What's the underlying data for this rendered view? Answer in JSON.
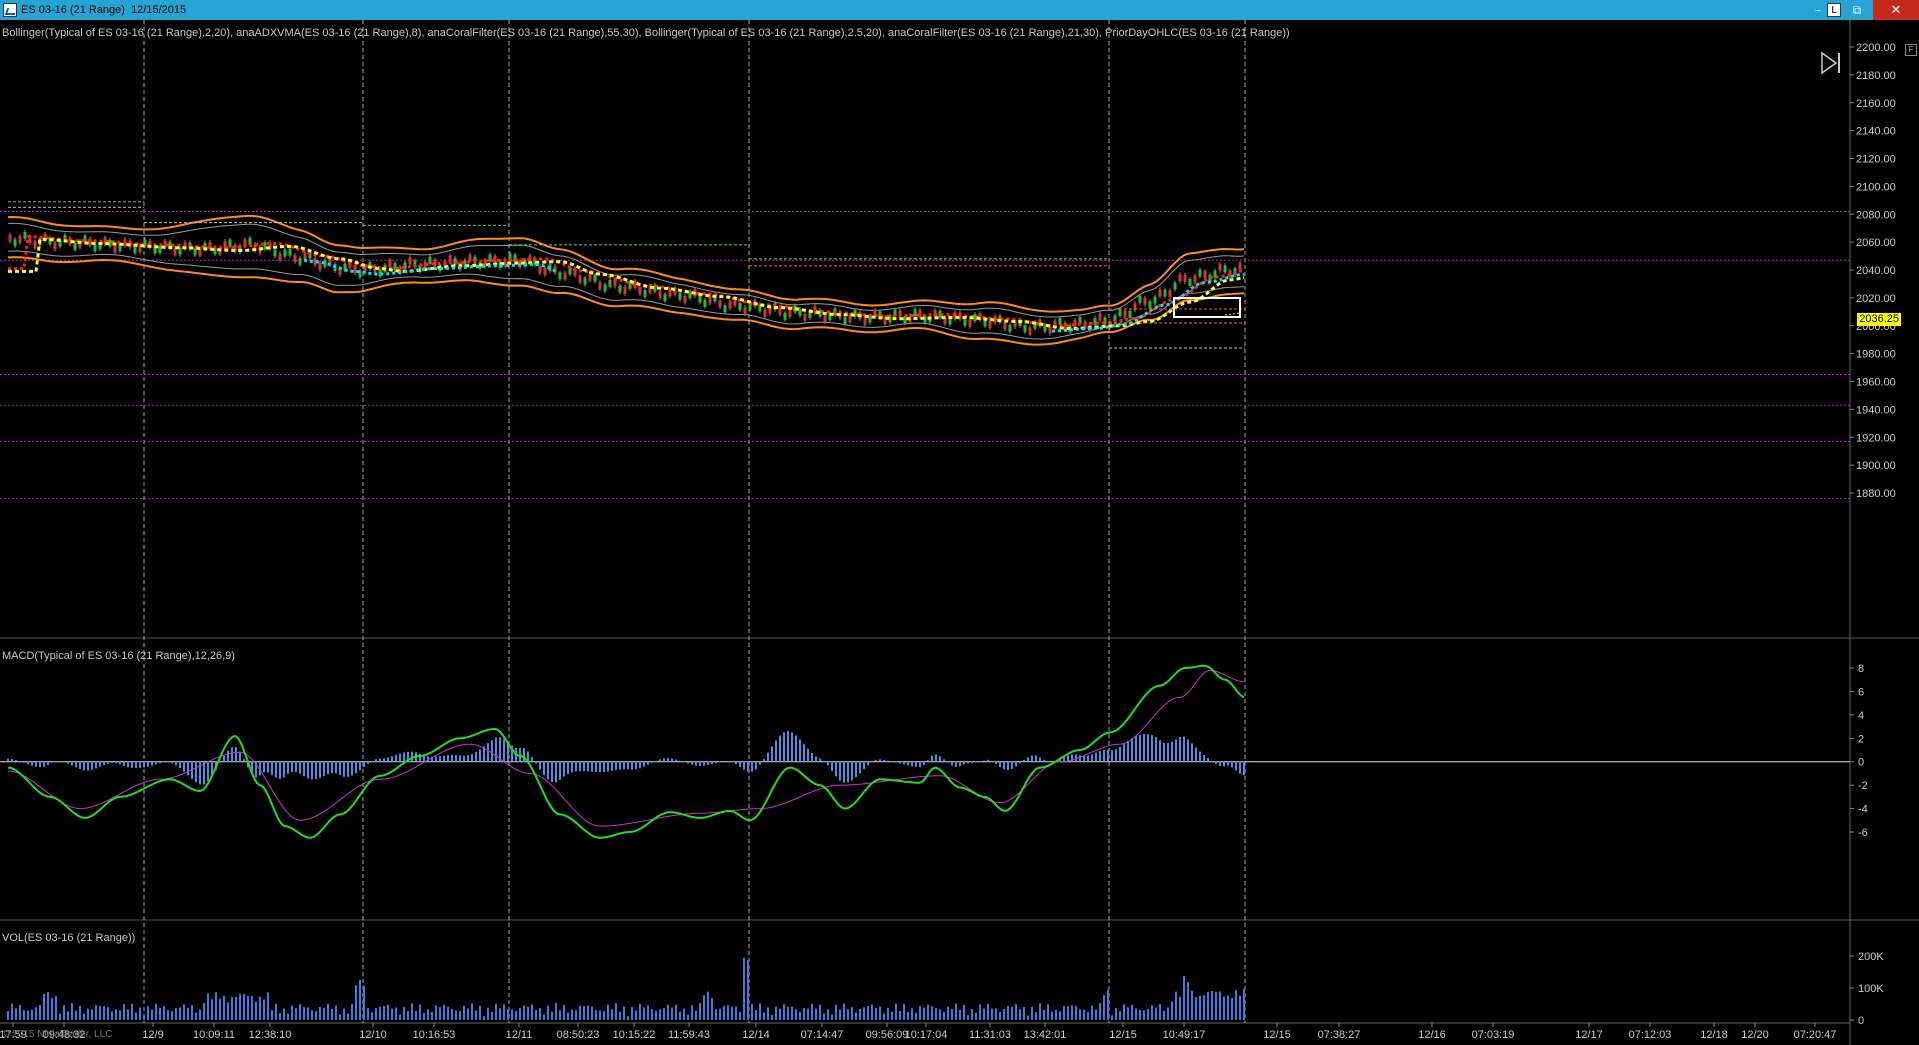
{
  "window": {
    "title": "ES 03-16 (21 Range)  12/15/2015",
    "buttons": {
      "minimize": "–",
      "link": "L",
      "restore": "⧉",
      "close": "✕"
    }
  },
  "panels": {
    "price": {
      "label": "Bollinger(Typical of ES 03-16 (21 Range),2,20), anaADXVMA(ES 03-16 (21 Range),8), anaCoralFilter(ES 03-16 (21 Range),55,30), Bollinger(Typical of ES 03-16 (21 Range),2.5,20), anaCoralFilter(ES 03-16 (21 Range),21,30), PriorDayOHLC(ES 03-16 (21 Range))",
      "y_ticks": [
        "2200.00",
        "2180.00",
        "2160.00",
        "2140.00",
        "2120.00",
        "2100.00",
        "2080.00",
        "2060.00",
        "2040.00",
        "2020.00",
        "2000.00",
        "1980.00",
        "1960.00",
        "1940.00",
        "1920.00",
        "1900.00",
        "1880.00"
      ],
      "last_price": "2036.25"
    },
    "macd": {
      "label": "MACD(Typical of ES 03-16 (21 Range),12,26,9)",
      "y_ticks": [
        "8",
        "6",
        "4",
        "2",
        "0",
        "-2",
        "-4",
        "-6"
      ]
    },
    "volume": {
      "label": "VOL(ES 03-16 (21 Range))",
      "y_ticks": [
        "200K",
        "100K",
        "0"
      ]
    }
  },
  "x_axis_labels": [
    "17:59",
    "09:48:32",
    "12/9",
    "10:09:11",
    "12:38:10",
    "12/10",
    "10:16:53",
    "12/11",
    "08:50:23",
    "10:15:22",
    "11:59:43",
    "12/14",
    "07:14:47",
    "09:56:09",
    "10:17:04",
    "11:31:03",
    "13:42:01",
    "12/15",
    "10:49:17",
    "12/15",
    "07:38:27",
    "12/16",
    "07:03:19",
    "12/17",
    "07:12:03",
    "12/18",
    "12/20",
    "07:20:47"
  ],
  "copyright": "© 2015 NinjaTrader, LLC",
  "colors": {
    "titlebar": "#27a4d6",
    "bollinger": "#ff8c1a",
    "adxvma": "#ff2020",
    "coral_fast": "#00e5ff",
    "coral_slow": "#ffff33",
    "prior_day_lines": "#c020c0",
    "macd_line": "#22dd22",
    "macd_signal": "#cc33cc",
    "histogram": "#4a8fe0",
    "volume": "#3a7ee0"
  }
}
